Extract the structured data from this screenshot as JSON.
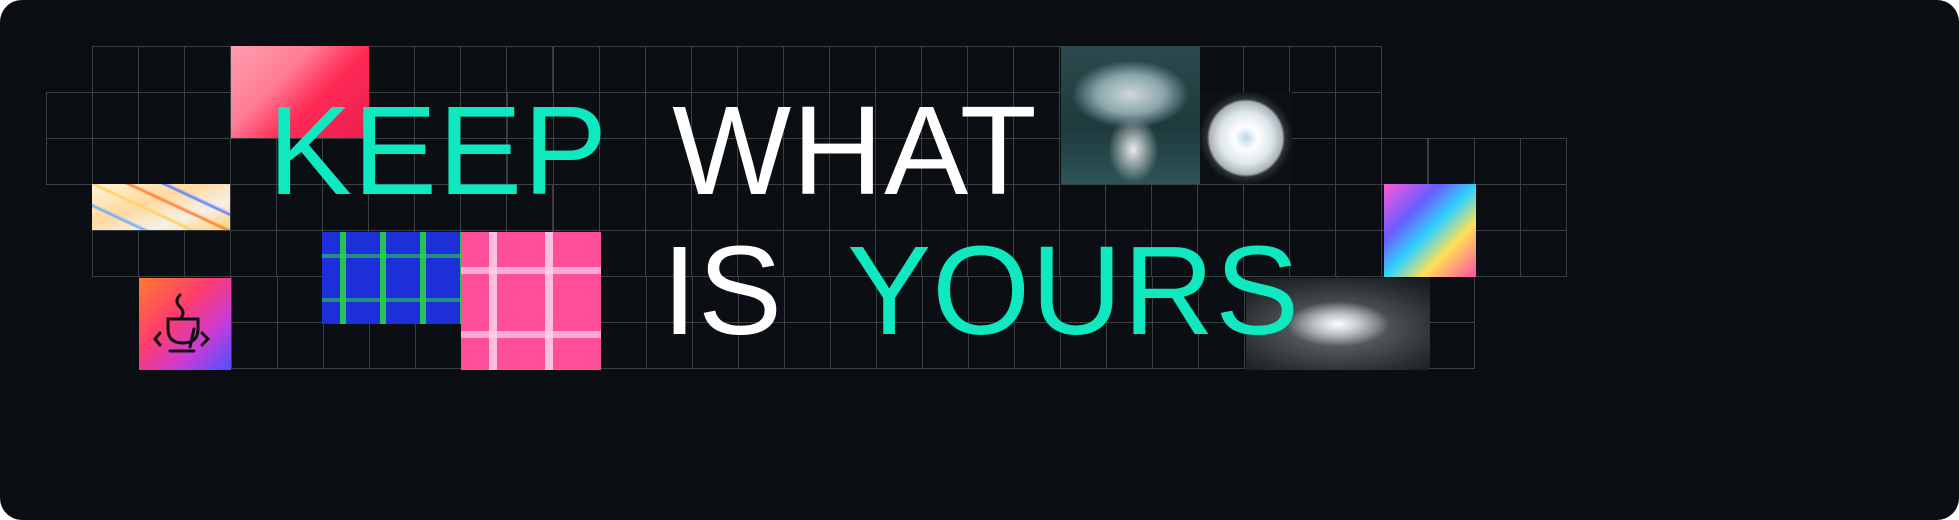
{
  "headline": {
    "line1": {
      "accent": "KEEP",
      "plain": "WHAT"
    },
    "line2": {
      "plain": "IS",
      "accent": "YOURS"
    }
  },
  "colors": {
    "background": "#0b0f13",
    "accent": "#10e8bf",
    "text": "#ffffff",
    "grid": "#3a3f44"
  },
  "tiles": [
    {
      "name": "pink-gradient-art"
    },
    {
      "name": "crystal-art"
    },
    {
      "name": "coffee-code-logo",
      "icon": "coffee-cup-code-icon"
    },
    {
      "name": "graffiti-art"
    },
    {
      "name": "pink-maze-art"
    },
    {
      "name": "stormy-cloud-art"
    },
    {
      "name": "pearl-orb-art"
    },
    {
      "name": "holographic-art"
    },
    {
      "name": "nebula-art"
    }
  ]
}
